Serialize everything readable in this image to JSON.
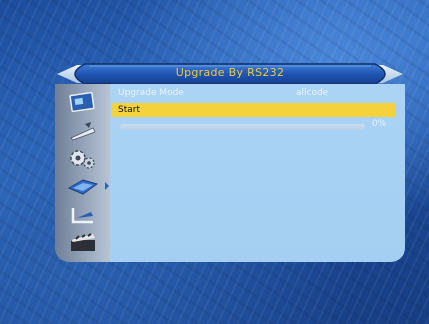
{
  "window": {
    "title": "Upgrade By RS232"
  },
  "menu": {
    "icons": [
      {
        "name": "picture-icon"
      },
      {
        "name": "satellite-dish-icon"
      },
      {
        "name": "settings-gears-icon"
      },
      {
        "name": "system-tools-icon",
        "selected": true
      },
      {
        "name": "usb-media-icon"
      },
      {
        "name": "clapperboard-icon"
      }
    ]
  },
  "settings": {
    "mode_label": "Upgrade Mode",
    "mode_value": "allcode",
    "start_label": "Start",
    "progress_text": "0%",
    "progress_value": 0
  },
  "colors": {
    "highlight": "#f4d23b",
    "title_text": "#f2c93a",
    "content_bg": "#aad3f4"
  }
}
